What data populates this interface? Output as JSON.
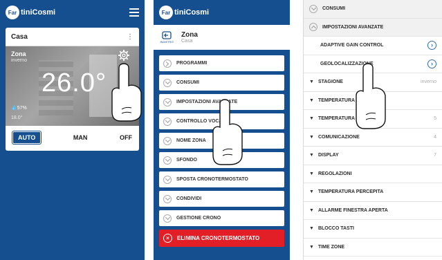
{
  "brand": {
    "logo_mark": "Far",
    "logo_text": "tiniCosmi"
  },
  "screen1": {
    "house": "Casa",
    "zone": {
      "name": "Zona",
      "subtitle": "inverno",
      "temperature": "26.0°",
      "humidity": "57%",
      "setpoint": "18.0°"
    },
    "modes": [
      "AUTO",
      "MAN",
      "OFF"
    ],
    "active_mode": "AUTO"
  },
  "screen2": {
    "header": {
      "back_label": "INDIETRO",
      "title": "Zona",
      "subtitle": "Casa"
    },
    "menu": [
      {
        "label": "PROGRAMMI",
        "icon": "chevron-right-icon"
      },
      {
        "label": "CONSUMI",
        "icon": "chevron-down-icon"
      },
      {
        "label": "IMPOSTAZIONI AVANZATE",
        "icon": "chevron-down-icon"
      },
      {
        "label": "CONTROLLO VOCALE",
        "icon": "chevron-down-icon"
      },
      {
        "label": "NOME ZONA",
        "icon": "chevron-down-icon"
      },
      {
        "label": "SFONDO",
        "icon": "chevron-down-icon"
      },
      {
        "label": "SPOSTA CRONOTERMOSTATO",
        "icon": "chevron-down-icon"
      },
      {
        "label": "CONDIVIDI",
        "icon": "chevron-down-icon"
      },
      {
        "label": "GESTIONE CRONO",
        "icon": "chevron-down-icon"
      }
    ],
    "delete_label": "ELIMINA CRONOTERMOSTATO"
  },
  "screen3": {
    "rows": [
      {
        "label": "CONSUMI",
        "value": ""
      },
      {
        "label": "IMPOSTAZIONI AVANZATE",
        "value": ""
      },
      {
        "label": "ADAPTIVE GAIN CONTROL",
        "value": ""
      },
      {
        "label": "GEOLOCALIZZAZIONE",
        "value": ""
      },
      {
        "label": "STAGIONE",
        "value": "inverno"
      },
      {
        "label": "TEMPERATURA ASSENTE",
        "value": ""
      },
      {
        "label": "TEMPERATURA ANTIGELO",
        "value": "5"
      },
      {
        "label": "COMUNICAZIONE",
        "value": "4"
      },
      {
        "label": "DISPLAY",
        "value": "7"
      },
      {
        "label": "REGOLAZIONI",
        "value": ""
      },
      {
        "label": "TEMPERATURA PERCEPITA",
        "value": ""
      },
      {
        "label": "ALLARME FINESTRA APERTA",
        "value": ""
      },
      {
        "label": "BLOCCO TASTI",
        "value": ""
      },
      {
        "label": "TIME ZONE",
        "value": ""
      }
    ]
  },
  "colors": {
    "brand_blue": "#164f8f",
    "danger_red": "#e21f26",
    "link_blue": "#2c6db5"
  }
}
